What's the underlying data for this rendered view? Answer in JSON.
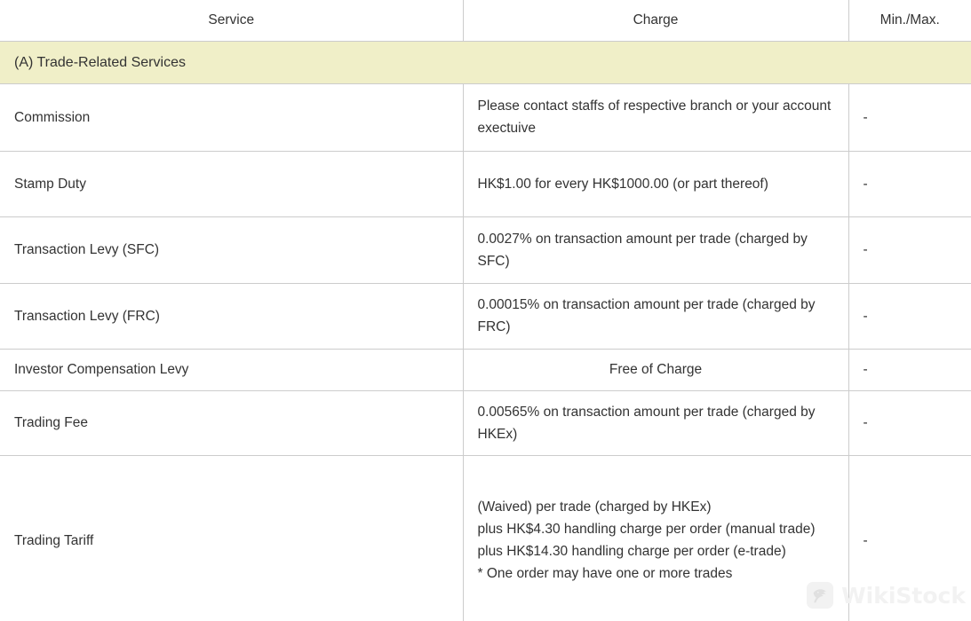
{
  "table": {
    "headers": {
      "service": "Service",
      "charge": "Charge",
      "minmax": "Min./Max."
    },
    "section": {
      "label": "(A) Trade-Related Services",
      "background_color": "#F0EFC8"
    },
    "border_color": "#CCCCCC",
    "text_color": "#333333",
    "rows": [
      {
        "service": "Commission",
        "charge": "Please contact staffs of respective branch or your account exectuive",
        "charge_align": "left",
        "minmax": "-"
      },
      {
        "service": "Stamp Duty",
        "charge": "HK$1.00 for every HK$1000.00 (or part thereof)",
        "charge_align": "left",
        "minmax": "-"
      },
      {
        "service": "Transaction Levy (SFC)",
        "charge": "0.0027% on transaction amount per trade (charged by SFC)",
        "charge_align": "left",
        "minmax": "-"
      },
      {
        "service": "Transaction Levy (FRC)",
        "charge": "0.00015% on transaction amount per trade (charged by FRC)",
        "charge_align": "left",
        "minmax": "-"
      },
      {
        "service": "Investor Compensation Levy",
        "charge": "Free of Charge",
        "charge_align": "center",
        "minmax": "-"
      },
      {
        "service": "Trading Fee",
        "charge": "0.00565% on transaction amount per trade (charged by HKEx)",
        "charge_align": "left",
        "minmax": "-"
      },
      {
        "service": "Trading Tariff",
        "charge": "(Waived) per trade (charged by HKEx)\nplus HK$4.30 handling charge per order (manual trade)\nplus HK$14.30 handling charge per order (e-trade)\n* One order may have one or more trades",
        "charge_align": "left",
        "minmax": "-"
      }
    ]
  },
  "watermark": {
    "text": "WikiStock",
    "color": "#F2F2F2"
  }
}
